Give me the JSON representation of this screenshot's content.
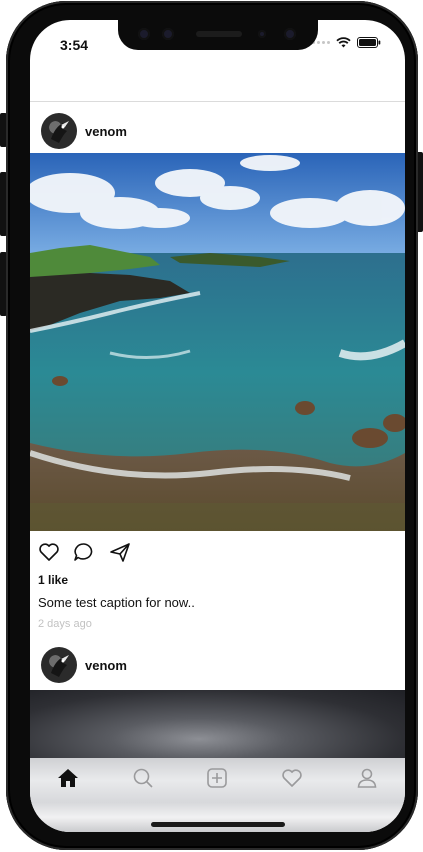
{
  "status_bar": {
    "time": "3:54",
    "icons": [
      "signal-dots-icon",
      "wifi-icon",
      "battery-icon"
    ]
  },
  "posts": [
    {
      "username": "venom",
      "image": "coastal-landscape-photo",
      "actions": [
        "heart-icon",
        "comment-icon",
        "share-icon"
      ],
      "likes": "1 like",
      "caption": "Some test caption for now..",
      "time_ago": "2 days ago"
    },
    {
      "username": "venom",
      "image": "dark-gradient-photo"
    }
  ],
  "tab_bar": {
    "tabs": [
      "home-icon",
      "search-icon",
      "add-post-icon",
      "activity-icon",
      "profile-icon"
    ],
    "active": "home-icon"
  },
  "colors": {
    "divider": "#dbdbdb",
    "muted_text": "#c2c2c2",
    "text": "#111111"
  }
}
